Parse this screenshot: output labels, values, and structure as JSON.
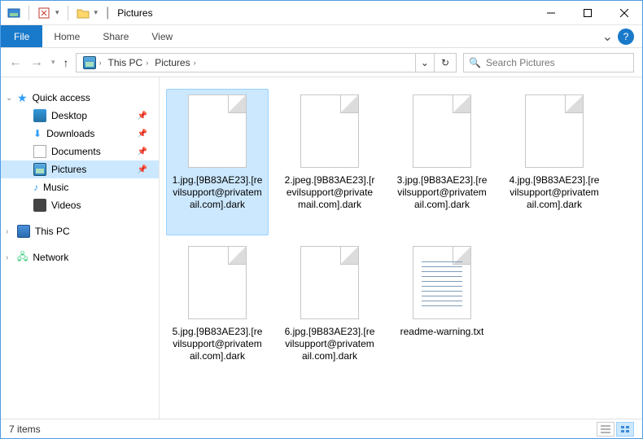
{
  "title": "Pictures",
  "tabs": {
    "file": "File",
    "home": "Home",
    "share": "Share",
    "view": "View"
  },
  "breadcrumb": {
    "root_sep": "›",
    "pc": "This PC",
    "folder": "Pictures"
  },
  "search": {
    "placeholder": "Search Pictures"
  },
  "sidebar": {
    "quick": "Quick access",
    "desktop": "Desktop",
    "downloads": "Downloads",
    "documents": "Documents",
    "pictures": "Pictures",
    "music": "Music",
    "videos": "Videos",
    "thispc": "This PC",
    "network": "Network"
  },
  "files": [
    {
      "name": "1.jpg.[9B83AE23].[revilsupport@privatemail.com].dark",
      "type": "file",
      "selected": true
    },
    {
      "name": "2.jpeg.[9B83AE23].[revilsupport@privatemail.com].dark",
      "type": "file",
      "selected": false
    },
    {
      "name": "3.jpg.[9B83AE23].[revilsupport@privatemail.com].dark",
      "type": "file",
      "selected": false
    },
    {
      "name": "4.jpg.[9B83AE23].[revilsupport@privatemail.com].dark",
      "type": "file",
      "selected": false
    },
    {
      "name": "5.jpg.[9B83AE23].[revilsupport@privatemail.com].dark",
      "type": "file",
      "selected": false
    },
    {
      "name": "6.jpg.[9B83AE23].[revilsupport@privatemail.com].dark",
      "type": "file",
      "selected": false
    },
    {
      "name": "readme-warning.txt",
      "type": "txt",
      "selected": false
    }
  ],
  "status": {
    "count": "7 items"
  }
}
